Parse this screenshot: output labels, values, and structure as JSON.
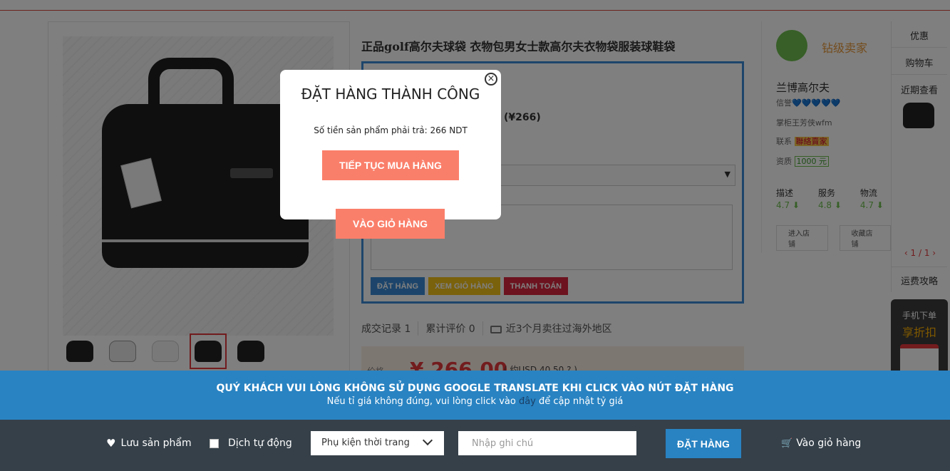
{
  "product": {
    "title": "正品golf高尔夫球袋 衣物包男女士款高尔夫衣物袋服装球鞋袋",
    "order_box_price": "(¥266)",
    "buttons": {
      "order": "ĐẶT HÀNG",
      "view_cart": "XEM GIỎ HÀNG",
      "pay": "THANH TOÁN"
    },
    "stats": {
      "deals": "成交记录 1",
      "reviews": "累计评价 0",
      "shipping": "近3个月卖往过海外地区"
    },
    "price_label": "价格",
    "price_value": "¥ 266.00",
    "price_usd": "( 约USD 40.50 ? )"
  },
  "seller": {
    "grade": "钻级卖家",
    "name": "兰博高尔夫",
    "reputation_label": "信誉",
    "reputation_hearts": "💙💙💙💙💙",
    "owner": "掌柜王芳侠wfm",
    "contact_label": "联系",
    "contact_tag": "聯絡賣家",
    "deposit_label": "资质",
    "deposit_value": "1000 元",
    "scores": [
      {
        "label": "描述",
        "value": "4.7 ⬇"
      },
      {
        "label": "服务",
        "value": "4.8 ⬇"
      },
      {
        "label": "物流",
        "value": "4.7 ⬇"
      }
    ],
    "links": [
      "进入店铺",
      "收藏店铺"
    ]
  },
  "sidebar": {
    "deals": "优惠",
    "cart": "购物车",
    "recent": "近期查看",
    "pager": "‹ 1 / 1 ›",
    "guide": "运费攻略",
    "mobile_line1": "手机下单",
    "mobile_line2": "享折扣"
  },
  "modal": {
    "title": "ĐẶT HÀNG THÀNH CÔNG",
    "close_icon": "close-circle-icon",
    "amount_text": "Số tiền sản phẩm phải trả: 266 NDT",
    "continue_label": "TIẾP TỤC MUA HÀNG",
    "cart_label": "VÀO GIỎ HÀNG"
  },
  "notice": {
    "title": "QUÝ KHÁCH VUI LÒNG KHÔNG SỬ DỤNG GOOGLE TRANSLATE KHI CLICK VÀO NÚT ĐẶT HÀNG",
    "sub_before": "Nếu tỉ giá không đúng, vui lòng click vào ",
    "sub_link": "đây",
    "sub_after": " để cập nhật tỷ giá"
  },
  "bottom_bar": {
    "save_label": "Lưu sản phẩm",
    "translate_label": "Dịch tự động",
    "category_selected": "Phụ kiện thời trang",
    "note_placeholder": "Nhập ghi chú",
    "order_label": "ĐẶT HÀNG",
    "cart_label": "Vào giỏ hàng"
  },
  "colors": {
    "accent_blue": "#2983c2",
    "button_salmon": "#fa7f6a",
    "bar_dark": "#354049",
    "price_red": "#e4393c"
  }
}
